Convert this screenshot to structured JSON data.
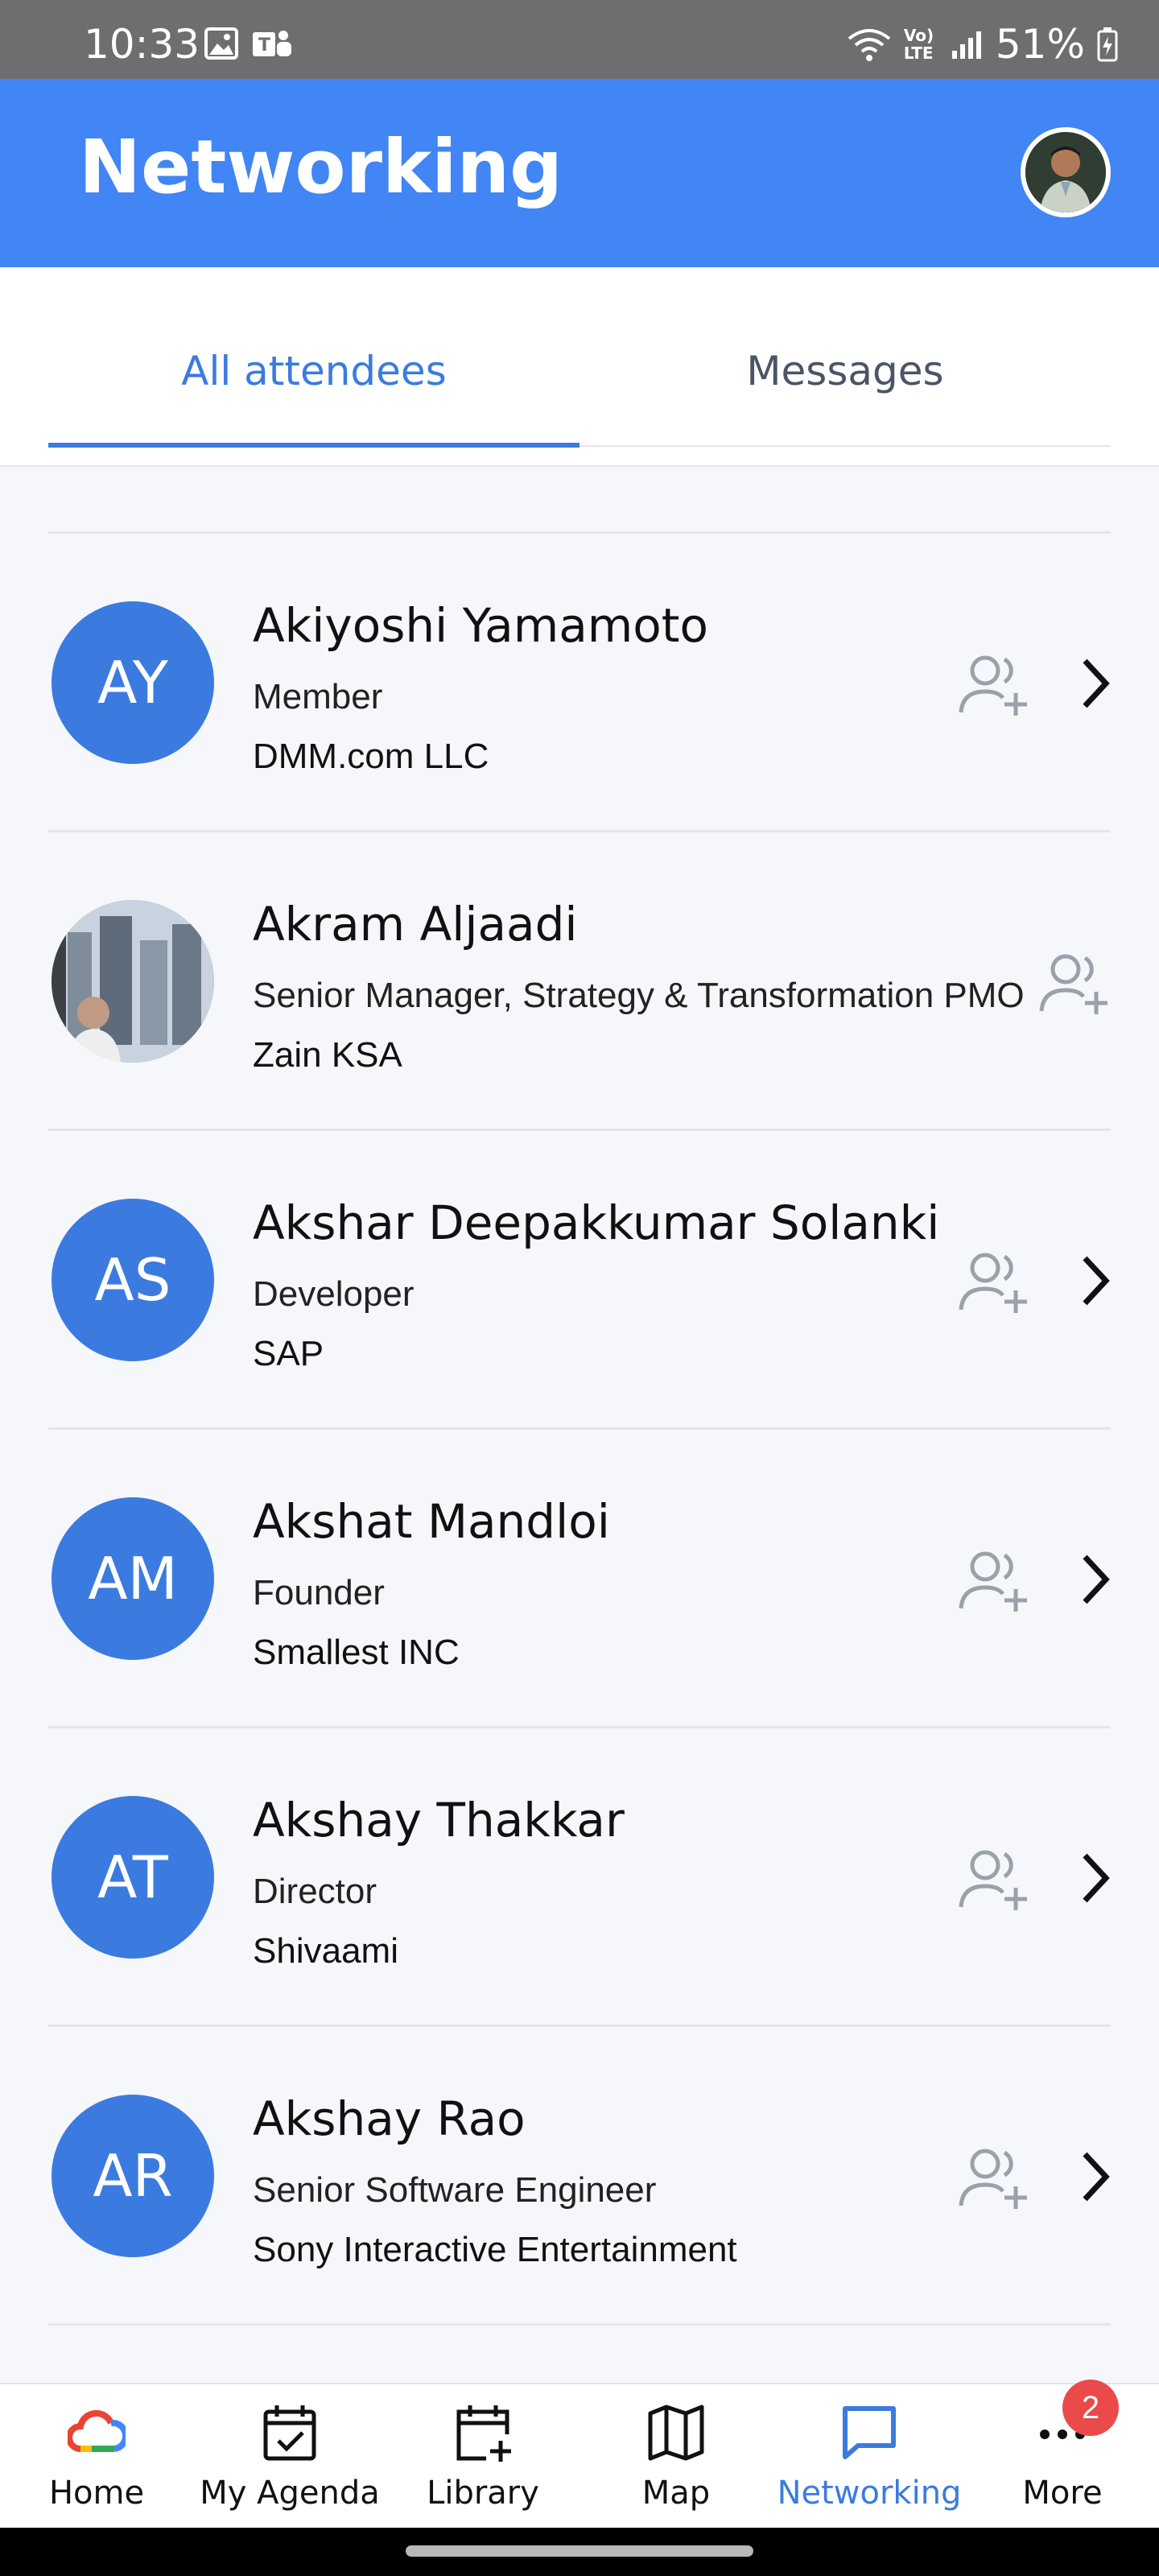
{
  "status_bar": {
    "time": "10:33",
    "battery": "51%",
    "network_label": "Vo) LTE"
  },
  "app_bar": {
    "title": "Networking"
  },
  "tabs": [
    {
      "label": "All attendees",
      "active": true
    },
    {
      "label": "Messages",
      "active": false
    }
  ],
  "attendees": [
    {
      "initials": "AY",
      "name": "Akiyoshi Yamamoto",
      "title": "Member",
      "company": "DMM.com LLC",
      "photo": false
    },
    {
      "initials": "",
      "name": "Akram Aljaadi",
      "title": "Senior Manager, Strategy & Transformation PMO",
      "company": "Zain KSA",
      "photo": true
    },
    {
      "initials": "AS",
      "name": "Akshar Deepakkumar Solanki",
      "title": "Developer",
      "company": "SAP",
      "photo": false
    },
    {
      "initials": "AM",
      "name": "Akshat Mandloi",
      "title": "Founder",
      "company": "Smallest INC",
      "photo": false
    },
    {
      "initials": "AT",
      "name": "Akshay Thakkar",
      "title": "Director",
      "company": "Shivaami",
      "photo": false
    },
    {
      "initials": "AR",
      "name": "Akshay Rao",
      "title": "Senior Software Engineer",
      "company": "Sony Interactive Entertainment",
      "photo": false
    }
  ],
  "bottom_nav": [
    {
      "label": "Home",
      "icon": "google-cloud-icon",
      "active": false
    },
    {
      "label": "My Agenda",
      "icon": "calendar-check-icon",
      "active": false
    },
    {
      "label": "Library",
      "icon": "calendar-add-icon",
      "active": false
    },
    {
      "label": "Map",
      "icon": "map-icon",
      "active": false
    },
    {
      "label": "Networking",
      "icon": "chat-icon",
      "active": true
    },
    {
      "label": "More",
      "icon": "more-dots-icon",
      "active": false
    }
  ],
  "more_badge": "2",
  "colors": {
    "primary": "#4285f4",
    "accent": "#3b7be0",
    "badge": "#ea4a4a"
  }
}
